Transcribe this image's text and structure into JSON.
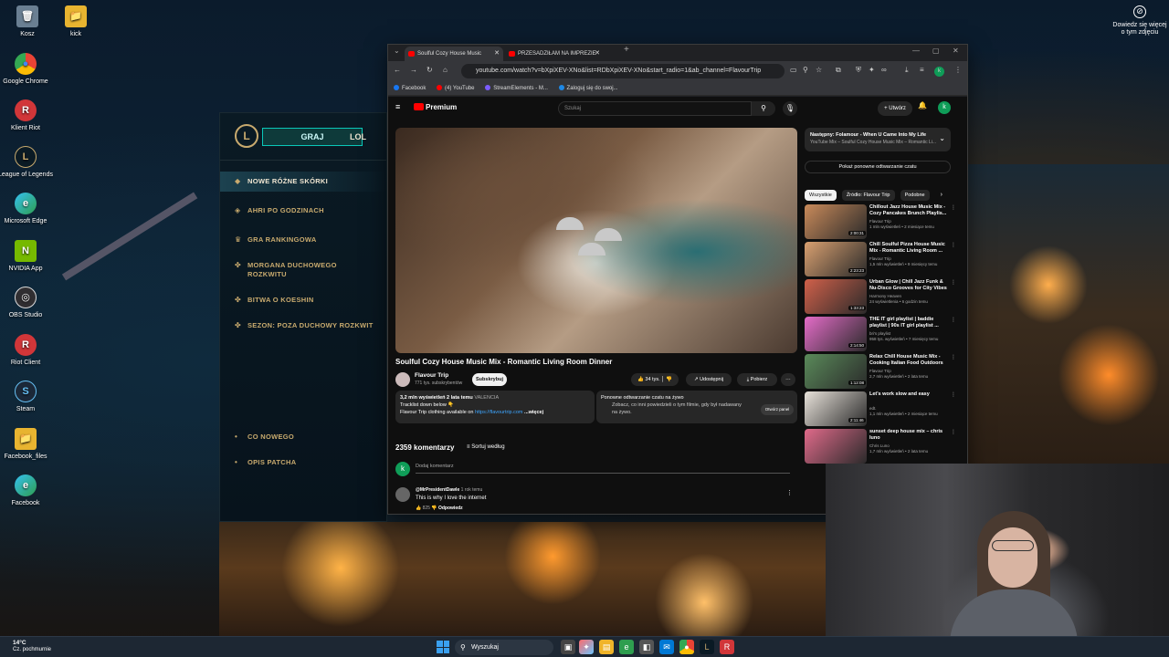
{
  "desktop": {
    "icons": [
      {
        "label": "Kosz",
        "glyph": "🗑"
      },
      {
        "label": "kick",
        "glyph": "📁"
      },
      {
        "label": "Google Chrome",
        "glyph": "●"
      },
      {
        "label": "Klient Riot",
        "glyph": "R"
      },
      {
        "label": "League of Legends",
        "glyph": "L"
      },
      {
        "label": "Microsoft Edge",
        "glyph": "e"
      },
      {
        "label": "NVIDIA App",
        "glyph": "N"
      },
      {
        "label": "OBS Studio",
        "glyph": "◎"
      },
      {
        "label": "Riot Client",
        "glyph": "R"
      },
      {
        "label": "Steam",
        "glyph": "S"
      },
      {
        "label": "Facebook_files",
        "glyph": "📁"
      },
      {
        "label": "Facebook",
        "glyph": "e"
      }
    ],
    "help_text": "Dowiedz się więcej o tym zdjęciu"
  },
  "lol": {
    "logo": "L",
    "play": "GRAJ",
    "lol_tab": "LOL",
    "items": [
      "NOWE RÓŻNE SKÓRKI",
      "AHRI PO GODZINACH",
      "GRA RANKINGOWA",
      "MORGANA DUCHOWEGO ROZKWITU",
      "BITWA O KOESHIN",
      "SEZON: POZA DUCHOWY ROZKWIT",
      "CO NOWEGO",
      "OPIS PATCHA"
    ]
  },
  "chrome": {
    "tabs": [
      {
        "title": "Soulful Cozy House Music"
      },
      {
        "title": "PRZESADZIŁAM NA IMPREZIE"
      }
    ],
    "url": "youtube.com/watch?v=bXpiXEV-XNo&list=RDbXpiXEV-XNo&start_radio=1&ab_channel=FlavourTrip",
    "bookmarks": [
      "Facebook",
      "(4) YouTube",
      "StreamElements - M...",
      "Zaloguj się do swoj..."
    ]
  },
  "youtube": {
    "logo": "Premium",
    "search_placeholder": "Szukaj",
    "create": "Utwórz",
    "avatar": "k",
    "video_title": "Soulful Cozy House Music Mix - Romantic Living Room Dinner",
    "channel": "Flavour Trip",
    "subs": "771 tys. subskrybentów",
    "subscribe": "Subskrybuj",
    "likes": "34 tys.",
    "share": "Udostępnij",
    "download": "Pobierz",
    "desc_stats": "3,2 mln wyświetleń  2 lata temu",
    "desc_location": "VALENCIA",
    "desc_line2": "Tracklist down below 👇",
    "desc_line3": "Flavour Trip clothing available on",
    "desc_link": "https://flavourtrip.com",
    "desc_more": "...więcej",
    "live_title": "Ponowne odtwarzanie czatu na żywo",
    "live_text": "Zobacz, co inni powiedzieli o tym filmie, gdy był nadawany na żywo.",
    "live_btn": "Otwórz panel",
    "comments_count": "2359 komentarzy",
    "sort": "Sortuj według",
    "add_comment": "Dodaj komentarz",
    "comment": {
      "author": "@MrPresidentDawle",
      "time": "1 rok temu",
      "text": "This is why I love the internet",
      "likes": "825",
      "reply": "Odpowiedz"
    },
    "up_next_title": "Następny: Folamour - When U Came Into My Life",
    "up_next_sub": "YouTube Mix – Soulful Cozy House Music Mix – Romantic Li...",
    "replay": "Pokaż ponowne odtwarzanie czatu",
    "chips": [
      "Wszystkie",
      "Źródło: Flavour Trip",
      "Podobne"
    ],
    "recs": [
      {
        "title": "Chillout Jazz House Music Mix - Cozy Pancakes Brunch Playlis...",
        "channel": "Flavour Trip",
        "meta": "1 mln wyświetleń • 2 miesiące temu",
        "duration": "2:00:31",
        "color": "#c98a5a"
      },
      {
        "title": "Chill Soulful Pizza House Music Mix - Romantic Living Room ...",
        "channel": "Flavour Trip",
        "meta": "1,5 mln wyświetleń • 9 miesięcy temu",
        "duration": "2:23:23",
        "color": "#d9a070"
      },
      {
        "title": "Urban Glow | Chill Jazz Funk & Nu-Disco Grooves for City Vibes",
        "channel": "Harmony Heaven",
        "meta": "24 wyświetlenia • 6 godzin temu",
        "duration": "1:33:23",
        "color": "#d0604a"
      },
      {
        "title": "THE IT girl playlist | baddie playlist | 90s IT girl playlist ...",
        "channel": "bri's playlist",
        "meta": "958 tys. wyświetleń • 7 miesięcy temu",
        "duration": "2:14:50",
        "color": "#e46cc8"
      },
      {
        "title": "Relax Chill House Music Mix - Cooking Italian Food Outdoors",
        "channel": "Flavour Trip",
        "meta": "2,7 mln wyświetleń • 2 lata temu",
        "duration": "1:12:08",
        "color": "#5a8a5a"
      },
      {
        "title": "Let's work slow and easy",
        "channel": "edt.",
        "meta": "1,1 mln wyświetleń • 2 miesiące temu",
        "duration": "2:11:46",
        "color": "#e8e2da"
      },
      {
        "title": "sunset deep house mix – chris luno",
        "channel": "Chris Luno",
        "meta": "1,7 mln wyświetleń • 2 lata temu",
        "duration": "",
        "color": "#e06a8a"
      }
    ]
  },
  "taskbar": {
    "temp": "14°C",
    "weather": "Cz. pochmurnie",
    "search": "Wyszukaj"
  }
}
